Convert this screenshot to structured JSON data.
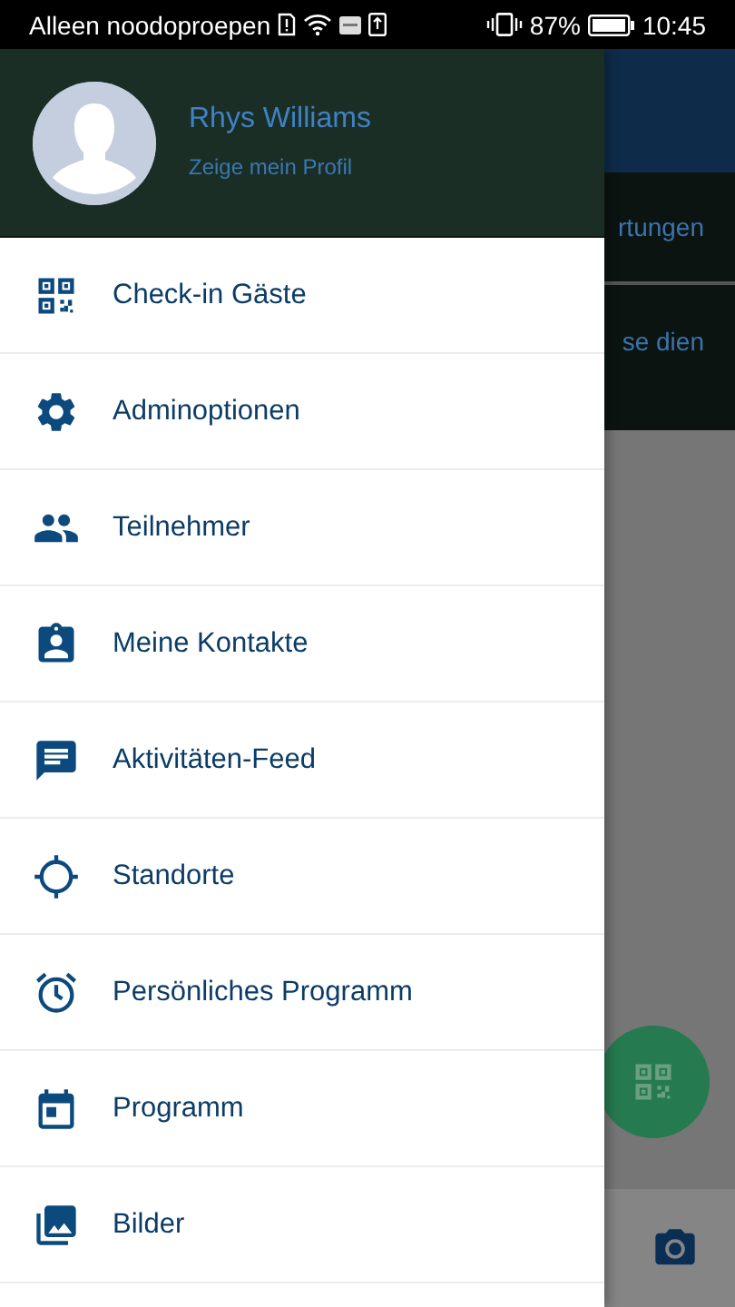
{
  "status_bar": {
    "carrier": "Alleen noodoproepen",
    "battery": "87%",
    "time": "10:45"
  },
  "background": {
    "tab_label": "rtungen",
    "text": "se dien"
  },
  "drawer": {
    "user_name": "Rhys Williams",
    "profile_link": "Zeige mein Profil",
    "items": [
      {
        "label": "Check-in Gäste"
      },
      {
        "label": "Adminoptionen"
      },
      {
        "label": "Teilnehmer"
      },
      {
        "label": "Meine Kontakte"
      },
      {
        "label": "Aktivitäten-Feed"
      },
      {
        "label": "Standorte"
      },
      {
        "label": "Persönliches Programm"
      },
      {
        "label": "Programm"
      },
      {
        "label": "Bilder"
      }
    ]
  }
}
